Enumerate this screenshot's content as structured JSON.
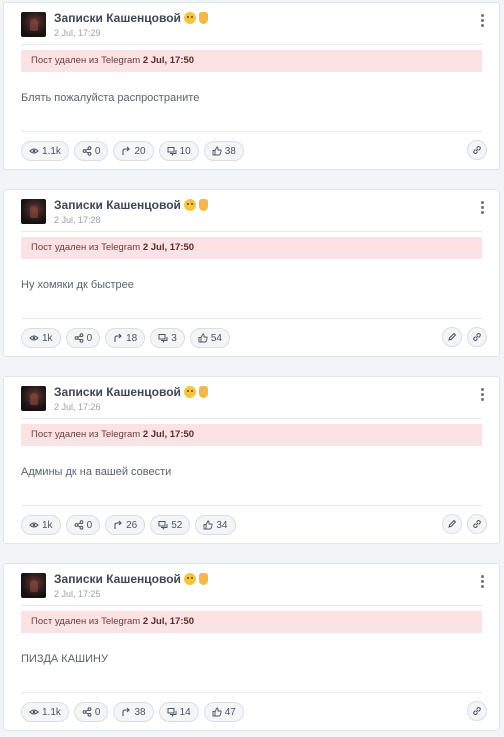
{
  "posts": [
    {
      "channel": "Записки Кашенцовой",
      "time": "2 Jul, 17:29",
      "deleted_prefix": "Пост удален из Telegram",
      "deleted_time": "2 Jul, 17:50",
      "text": "Блять пожалуйста распространите",
      "stats": {
        "views": "1.1k",
        "shares": "0",
        "forwards": "20",
        "comments": "10",
        "reactions": "38"
      },
      "has_edit": false
    },
    {
      "channel": "Записки Кашенцовой",
      "time": "2 Jul, 17:28",
      "deleted_prefix": "Пост удален из Telegram",
      "deleted_time": "2 Jul, 17:50",
      "text": "Ну хомяки дк быстрее",
      "stats": {
        "views": "1k",
        "shares": "0",
        "forwards": "18",
        "comments": "3",
        "reactions": "54"
      },
      "has_edit": true
    },
    {
      "channel": "Записки Кашенцовой",
      "time": "2 Jul, 17:26",
      "deleted_prefix": "Пост удален из Telegram",
      "deleted_time": "2 Jul, 17:50",
      "text": "Админы дк на вашей совести",
      "stats": {
        "views": "1k",
        "shares": "0",
        "forwards": "26",
        "comments": "52",
        "reactions": "34"
      },
      "has_edit": true
    },
    {
      "channel": "Записки Кашенцовой",
      "time": "2 Jul, 17:25",
      "deleted_prefix": "Пост удален из Telegram",
      "deleted_time": "2 Jul, 17:50",
      "text": "ПИЗДА КАШИНУ",
      "stats": {
        "views": "1.1k",
        "shares": "0",
        "forwards": "38",
        "comments": "14",
        "reactions": "47"
      },
      "has_edit": false
    }
  ],
  "icons": [
    "eye-icon",
    "share-nodes-icon",
    "forward-arrow-icon",
    "comments-icon",
    "thumbs-up-icon",
    "pencil-icon",
    "link-icon",
    "more-vertical-icon"
  ],
  "colors": {
    "deleted_banner_bg": "#fde2e3",
    "card_bg": "#ffffff",
    "page_bg": "#f2f4f7"
  }
}
